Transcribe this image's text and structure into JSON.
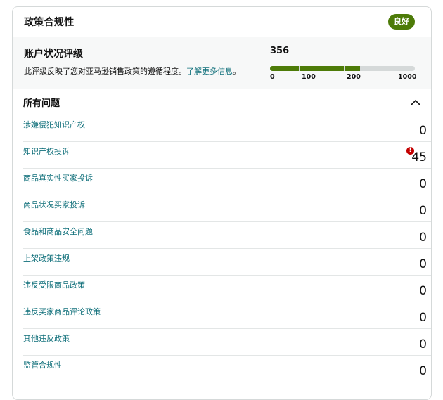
{
  "header": {
    "title": "政策合规性",
    "badge": "良好"
  },
  "rating": {
    "heading": "账户状况评级",
    "description": "此评级反映了您对亚马逊销售政策的遵循程度。",
    "learn_more": "了解更多信息",
    "description_end": "。",
    "score": "356",
    "ticks": [
      "0",
      "100",
      "200",
      "1000"
    ],
    "score_fraction": 0.356
  },
  "issues": {
    "title": "所有问题",
    "items": [
      {
        "label": "涉嫌侵犯知识产权",
        "count": "0"
      },
      {
        "label": "知识产权投诉",
        "count": "45",
        "alert": "!"
      },
      {
        "label": "商品真实性买家投诉",
        "count": "0"
      },
      {
        "label": "商品状况买家投诉",
        "count": "0"
      },
      {
        "label": "食品和商品安全问题",
        "count": "0"
      },
      {
        "label": "上架政策违规",
        "count": "0"
      },
      {
        "label": "违反受限商品政策",
        "count": "0"
      },
      {
        "label": "违反买家商品评论政策",
        "count": "0"
      },
      {
        "label": "其他违反政策",
        "count": "0"
      },
      {
        "label": "监管合规性",
        "count": "0"
      }
    ]
  },
  "colors": {
    "accent_green": "#4d7b08",
    "link_teal": "#0f6f7a",
    "alert_red": "#c40000"
  },
  "icons": {
    "collapse": "chevron-up-icon",
    "alert": "alert-circle-icon"
  }
}
